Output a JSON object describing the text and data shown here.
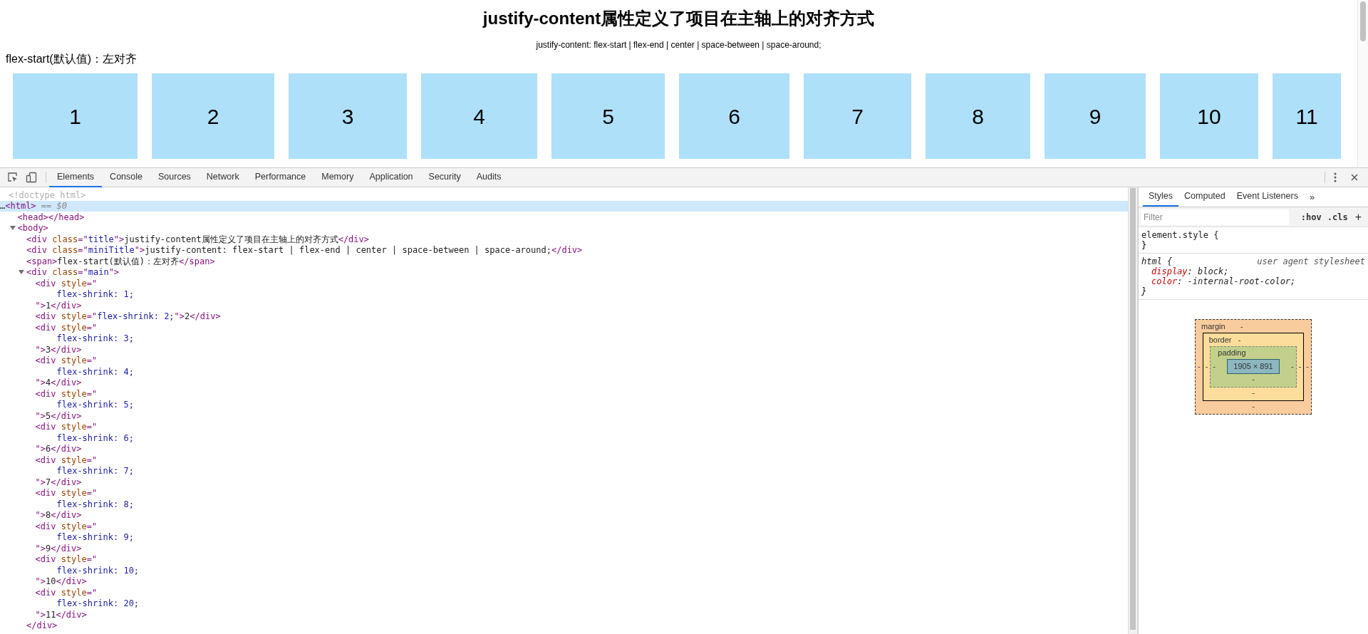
{
  "page": {
    "title": "justify-content属性定义了项目在主轴上的对齐方式",
    "subtitle": "justify-content: flex-start | flex-end | center | space-between | space-around;",
    "label": "flex-start(默认值)：左对齐",
    "items": [
      "1",
      "2",
      "3",
      "4",
      "5",
      "6",
      "7",
      "8",
      "9",
      "10",
      "11"
    ]
  },
  "devtools": {
    "tabs": [
      {
        "label": "Elements",
        "selected": true
      },
      {
        "label": "Console",
        "selected": false
      },
      {
        "label": "Sources",
        "selected": false
      },
      {
        "label": "Network",
        "selected": false
      },
      {
        "label": "Performance",
        "selected": false
      },
      {
        "label": "Memory",
        "selected": false
      },
      {
        "label": "Application",
        "selected": false
      },
      {
        "label": "Security",
        "selected": false
      },
      {
        "label": "Audits",
        "selected": false
      }
    ],
    "elements": {
      "nodes": [
        {
          "kind": "leaf",
          "selected": false,
          "lines": [
            {
              "kind": "tag-line",
              "tokens": [
                {
                  "kind": "doctype",
                  "text": "<!doctype html>"
                }
              ]
            }
          ]
        },
        {
          "kind": "root",
          "selected": true,
          "lines": [
            {
              "kind": "tag-line",
              "tokens": [
                {
                  "kind": "text",
                  "text": "…"
                },
                {
                  "kind": "tag",
                  "text": "<html>"
                },
                {
                  "kind": "hint",
                  "text": " == "
                },
                {
                  "kind": "hint-italic",
                  "text": "$0"
                }
              ]
            }
          ],
          "children": [
            {
              "kind": "leaf",
              "selected": false,
              "lines": [
                {
                  "kind": "tag-line",
                  "tokens": [
                    {
                      "kind": "tag",
                      "text": "<head></head>"
                    }
                  ]
                }
              ]
            },
            {
              "kind": "parent",
              "expanded": true,
              "selected": false,
              "lines": [
                {
                  "kind": "tag-line",
                  "tokens": [
                    {
                      "kind": "tag",
                      "text": "<body>"
                    }
                  ]
                }
              ],
              "children": [
                {
                  "kind": "leaf",
                  "selected": false,
                  "lines": [
                    {
                      "kind": "tag-line",
                      "tokens": [
                        {
                          "kind": "tag",
                          "text": "<div"
                        },
                        {
                          "kind": "attr",
                          "text": " class"
                        },
                        {
                          "kind": "tag",
                          "text": "=\""
                        },
                        {
                          "kind": "value",
                          "text": "title"
                        },
                        {
                          "kind": "tag",
                          "text": "\">"
                        },
                        {
                          "kind": "text",
                          "text": "justify-content属性定义了项目在主轴上的对齐方式"
                        },
                        {
                          "kind": "tag",
                          "text": "</div>"
                        }
                      ]
                    }
                  ]
                },
                {
                  "kind": "leaf",
                  "selected": false,
                  "lines": [
                    {
                      "kind": "tag-line",
                      "tokens": [
                        {
                          "kind": "tag",
                          "text": "<div"
                        },
                        {
                          "kind": "attr",
                          "text": " class"
                        },
                        {
                          "kind": "tag",
                          "text": "=\""
                        },
                        {
                          "kind": "value",
                          "text": "miniTitle"
                        },
                        {
                          "kind": "tag",
                          "text": "\">"
                        },
                        {
                          "kind": "text",
                          "text": "justify-content: flex-start | flex-end | center | space-between | space-around;"
                        },
                        {
                          "kind": "tag",
                          "text": "</div>"
                        }
                      ]
                    }
                  ]
                },
                {
                  "kind": "leaf",
                  "selected": false,
                  "lines": [
                    {
                      "kind": "tag-line",
                      "tokens": [
                        {
                          "kind": "tag",
                          "text": "<span>"
                        },
                        {
                          "kind": "text",
                          "text": "flex-start(默认值)：左对齐"
                        },
                        {
                          "kind": "tag",
                          "text": "</span>"
                        }
                      ]
                    }
                  ]
                },
                {
                  "kind": "parent",
                  "expanded": true,
                  "selected": false,
                  "lines": [
                    {
                      "kind": "tag-line",
                      "tokens": [
                        {
                          "kind": "tag",
                          "text": "<div"
                        },
                        {
                          "kind": "attr",
                          "text": " class"
                        },
                        {
                          "kind": "tag",
                          "text": "=\""
                        },
                        {
                          "kind": "value",
                          "text": "main"
                        },
                        {
                          "kind": "tag",
                          "text": "\">"
                        }
                      ]
                    }
                  ],
                  "close": [
                    {
                      "kind": "tag",
                      "text": "</div>"
                    }
                  ],
                  "children": [
                    {
                      "kind": "leaf",
                      "selected": false,
                      "lines": [
                        {
                          "kind": "tag-line",
                          "tokens": [
                            {
                              "kind": "tag",
                              "text": "<div"
                            },
                            {
                              "kind": "attr",
                              "text": " style"
                            },
                            {
                              "kind": "tag",
                              "text": "=\""
                            }
                          ]
                        },
                        {
                          "kind": "value-line",
                          "tokens": [
                            {
                              "kind": "value",
                              "text": "flex-shrink: 1;"
                            }
                          ]
                        },
                        {
                          "kind": "tag-line",
                          "tokens": [
                            {
                              "kind": "tag",
                              "text": "\">"
                            },
                            {
                              "kind": "text",
                              "text": "1"
                            },
                            {
                              "kind": "tag",
                              "text": "</div>"
                            }
                          ]
                        }
                      ]
                    },
                    {
                      "kind": "leaf",
                      "selected": false,
                      "lines": [
                        {
                          "kind": "tag-line",
                          "tokens": [
                            {
                              "kind": "tag",
                              "text": "<div"
                            },
                            {
                              "kind": "attr",
                              "text": " style"
                            },
                            {
                              "kind": "tag",
                              "text": "=\""
                            },
                            {
                              "kind": "value",
                              "text": "flex-shrink: 2;"
                            },
                            {
                              "kind": "tag",
                              "text": "\">"
                            },
                            {
                              "kind": "text",
                              "text": "2"
                            },
                            {
                              "kind": "tag",
                              "text": "</div>"
                            }
                          ]
                        }
                      ]
                    },
                    {
                      "kind": "leaf",
                      "selected": false,
                      "lines": [
                        {
                          "kind": "tag-line",
                          "tokens": [
                            {
                              "kind": "tag",
                              "text": "<div"
                            },
                            {
                              "kind": "attr",
                              "text": " style"
                            },
                            {
                              "kind": "tag",
                              "text": "=\""
                            }
                          ]
                        },
                        {
                          "kind": "value-line",
                          "tokens": [
                            {
                              "kind": "value",
                              "text": "flex-shrink: 3;"
                            }
                          ]
                        },
                        {
                          "kind": "tag-line",
                          "tokens": [
                            {
                              "kind": "tag",
                              "text": "\">"
                            },
                            {
                              "kind": "text",
                              "text": "3"
                            },
                            {
                              "kind": "tag",
                              "text": "</div>"
                            }
                          ]
                        }
                      ]
                    },
                    {
                      "kind": "leaf",
                      "selected": false,
                      "lines": [
                        {
                          "kind": "tag-line",
                          "tokens": [
                            {
                              "kind": "tag",
                              "text": "<div"
                            },
                            {
                              "kind": "attr",
                              "text": " style"
                            },
                            {
                              "kind": "tag",
                              "text": "=\""
                            }
                          ]
                        },
                        {
                          "kind": "value-line",
                          "tokens": [
                            {
                              "kind": "value",
                              "text": "flex-shrink: 4;"
                            }
                          ]
                        },
                        {
                          "kind": "tag-line",
                          "tokens": [
                            {
                              "kind": "tag",
                              "text": "\">"
                            },
                            {
                              "kind": "text",
                              "text": "4"
                            },
                            {
                              "kind": "tag",
                              "text": "</div>"
                            }
                          ]
                        }
                      ]
                    },
                    {
                      "kind": "leaf",
                      "selected": false,
                      "lines": [
                        {
                          "kind": "tag-line",
                          "tokens": [
                            {
                              "kind": "tag",
                              "text": "<div"
                            },
                            {
                              "kind": "attr",
                              "text": " style"
                            },
                            {
                              "kind": "tag",
                              "text": "=\""
                            }
                          ]
                        },
                        {
                          "kind": "value-line",
                          "tokens": [
                            {
                              "kind": "value",
                              "text": "flex-shrink: 5;"
                            }
                          ]
                        },
                        {
                          "kind": "tag-line",
                          "tokens": [
                            {
                              "kind": "tag",
                              "text": "\">"
                            },
                            {
                              "kind": "text",
                              "text": "5"
                            },
                            {
                              "kind": "tag",
                              "text": "</div>"
                            }
                          ]
                        }
                      ]
                    },
                    {
                      "kind": "leaf",
                      "selected": false,
                      "lines": [
                        {
                          "kind": "tag-line",
                          "tokens": [
                            {
                              "kind": "tag",
                              "text": "<div"
                            },
                            {
                              "kind": "attr",
                              "text": " style"
                            },
                            {
                              "kind": "tag",
                              "text": "=\""
                            }
                          ]
                        },
                        {
                          "kind": "value-line",
                          "tokens": [
                            {
                              "kind": "value",
                              "text": "flex-shrink: 6;"
                            }
                          ]
                        },
                        {
                          "kind": "tag-line",
                          "tokens": [
                            {
                              "kind": "tag",
                              "text": "\">"
                            },
                            {
                              "kind": "text",
                              "text": "6"
                            },
                            {
                              "kind": "tag",
                              "text": "</div>"
                            }
                          ]
                        }
                      ]
                    },
                    {
                      "kind": "leaf",
                      "selected": false,
                      "lines": [
                        {
                          "kind": "tag-line",
                          "tokens": [
                            {
                              "kind": "tag",
                              "text": "<div"
                            },
                            {
                              "kind": "attr",
                              "text": " style"
                            },
                            {
                              "kind": "tag",
                              "text": "=\""
                            }
                          ]
                        },
                        {
                          "kind": "value-line",
                          "tokens": [
                            {
                              "kind": "value",
                              "text": "flex-shrink: 7;"
                            }
                          ]
                        },
                        {
                          "kind": "tag-line",
                          "tokens": [
                            {
                              "kind": "tag",
                              "text": "\">"
                            },
                            {
                              "kind": "text",
                              "text": "7"
                            },
                            {
                              "kind": "tag",
                              "text": "</div>"
                            }
                          ]
                        }
                      ]
                    },
                    {
                      "kind": "leaf",
                      "selected": false,
                      "lines": [
                        {
                          "kind": "tag-line",
                          "tokens": [
                            {
                              "kind": "tag",
                              "text": "<div"
                            },
                            {
                              "kind": "attr",
                              "text": " style"
                            },
                            {
                              "kind": "tag",
                              "text": "=\""
                            }
                          ]
                        },
                        {
                          "kind": "value-line",
                          "tokens": [
                            {
                              "kind": "value",
                              "text": "flex-shrink: 8;"
                            }
                          ]
                        },
                        {
                          "kind": "tag-line",
                          "tokens": [
                            {
                              "kind": "tag",
                              "text": "\">"
                            },
                            {
                              "kind": "text",
                              "text": "8"
                            },
                            {
                              "kind": "tag",
                              "text": "</div>"
                            }
                          ]
                        }
                      ]
                    },
                    {
                      "kind": "leaf",
                      "selected": false,
                      "lines": [
                        {
                          "kind": "tag-line",
                          "tokens": [
                            {
                              "kind": "tag",
                              "text": "<div"
                            },
                            {
                              "kind": "attr",
                              "text": " style"
                            },
                            {
                              "kind": "tag",
                              "text": "=\""
                            }
                          ]
                        },
                        {
                          "kind": "value-line",
                          "tokens": [
                            {
                              "kind": "value",
                              "text": "flex-shrink: 9;"
                            }
                          ]
                        },
                        {
                          "kind": "tag-line",
                          "tokens": [
                            {
                              "kind": "tag",
                              "text": "\">"
                            },
                            {
                              "kind": "text",
                              "text": "9"
                            },
                            {
                              "kind": "tag",
                              "text": "</div>"
                            }
                          ]
                        }
                      ]
                    },
                    {
                      "kind": "leaf",
                      "selected": false,
                      "lines": [
                        {
                          "kind": "tag-line",
                          "tokens": [
                            {
                              "kind": "tag",
                              "text": "<div"
                            },
                            {
                              "kind": "attr",
                              "text": " style"
                            },
                            {
                              "kind": "tag",
                              "text": "=\""
                            }
                          ]
                        },
                        {
                          "kind": "value-line",
                          "tokens": [
                            {
                              "kind": "value",
                              "text": "flex-shrink: 10;"
                            }
                          ]
                        },
                        {
                          "kind": "tag-line",
                          "tokens": [
                            {
                              "kind": "tag",
                              "text": "\">"
                            },
                            {
                              "kind": "text",
                              "text": "10"
                            },
                            {
                              "kind": "tag",
                              "text": "</div>"
                            }
                          ]
                        }
                      ]
                    },
                    {
                      "kind": "leaf",
                      "selected": false,
                      "lines": [
                        {
                          "kind": "tag-line",
                          "tokens": [
                            {
                              "kind": "tag",
                              "text": "<div"
                            },
                            {
                              "kind": "attr",
                              "text": " style"
                            },
                            {
                              "kind": "tag",
                              "text": "=\""
                            }
                          ]
                        },
                        {
                          "kind": "value-line",
                          "tokens": [
                            {
                              "kind": "value",
                              "text": "flex-shrink: 20;"
                            }
                          ]
                        },
                        {
                          "kind": "tag-line",
                          "tokens": [
                            {
                              "kind": "tag",
                              "text": "\">"
                            },
                            {
                              "kind": "text",
                              "text": "11"
                            },
                            {
                              "kind": "tag",
                              "text": "</div>"
                            }
                          ]
                        }
                      ]
                    }
                  ]
                }
              ]
            }
          ]
        }
      ]
    },
    "styles": {
      "tabs": [
        {
          "label": "Styles",
          "selected": true
        },
        {
          "label": "Computed",
          "selected": false
        },
        {
          "label": "Event Listeners",
          "selected": false
        }
      ],
      "more": "»",
      "filter": {
        "placeholder": "Filter"
      },
      "toggles": [
        ":hov",
        ".cls"
      ],
      "add": "+",
      "rules": [
        {
          "kind": "inline",
          "selector": "element.style {",
          "close": "}"
        },
        {
          "kind": "user-agent",
          "selector": "html {",
          "source": "user agent stylesheet",
          "declarations": [
            {
              "property": "display",
              "colon": ":",
              "value": " block;"
            },
            {
              "property": "color",
              "colon": ":",
              "value": " -internal-root-color;"
            }
          ],
          "close": "}"
        }
      ],
      "box_model": {
        "margin": {
          "label": "margin",
          "top": "-",
          "right": "-",
          "bottom": "-",
          "left": "-"
        },
        "border": {
          "label": "border",
          "top": "-",
          "right": "-",
          "bottom": "-",
          "left": "-"
        },
        "padding": {
          "label": "padding",
          "right": "-",
          "bottom": "-",
          "left": "-"
        },
        "content": "1905 × 891"
      }
    }
  }
}
